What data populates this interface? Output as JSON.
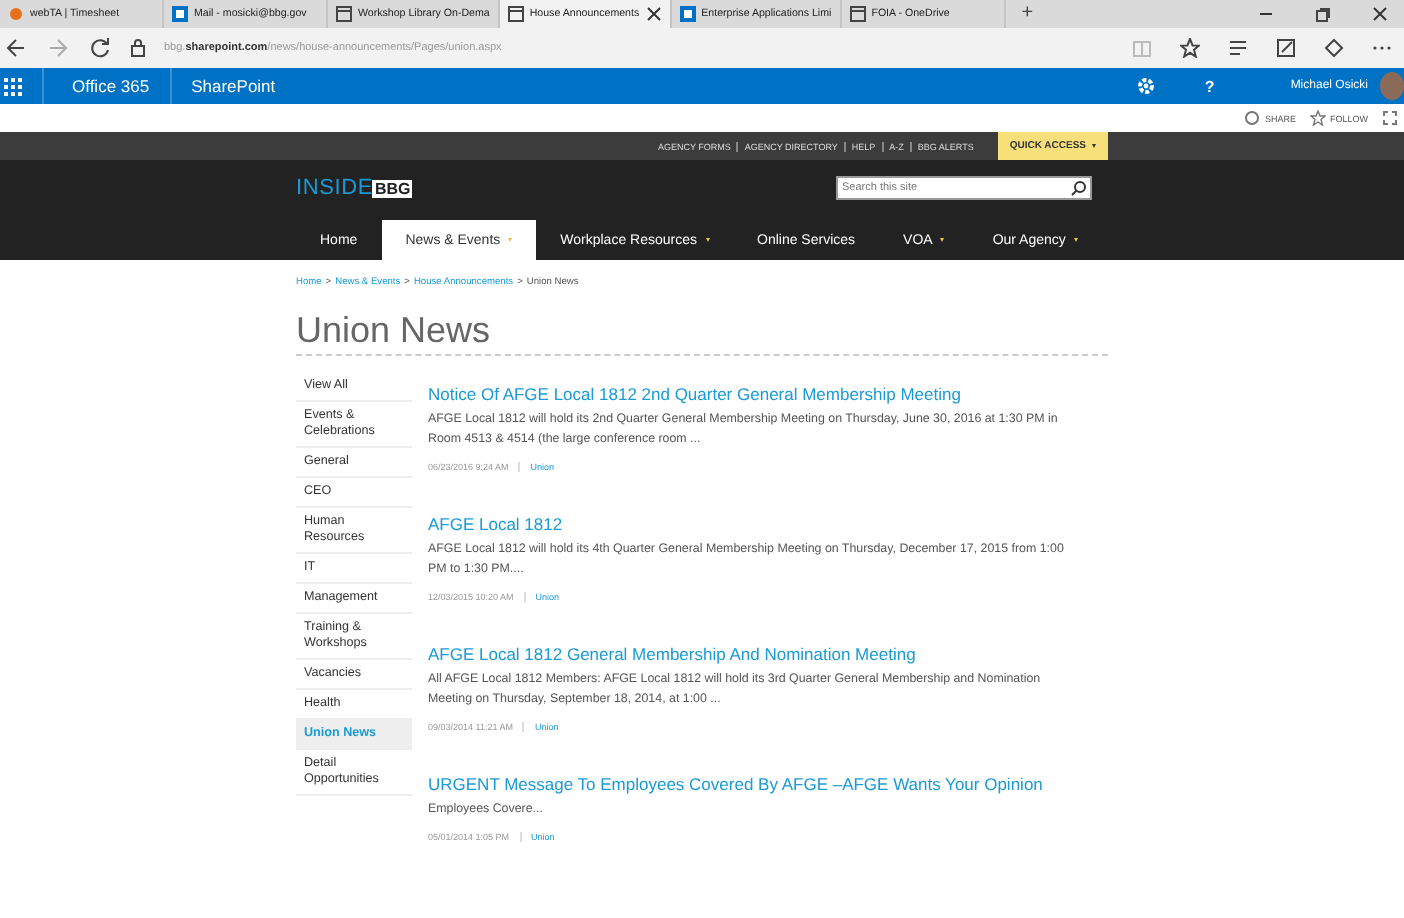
{
  "browser": {
    "tabs": [
      {
        "title": "webTA | Timesheet",
        "selected": false,
        "kind": "clock"
      },
      {
        "title": "Mail - mosicki@bbg.gov",
        "selected": false,
        "kind": "mail"
      },
      {
        "title": "Workshop Library On-Dema",
        "selected": false,
        "kind": "page"
      },
      {
        "title": "House Announcements",
        "selected": true,
        "kind": "page"
      },
      {
        "title": "Enterprise Applications Limi",
        "selected": false,
        "kind": "mail"
      },
      {
        "title": "FOIA - OneDrive",
        "selected": false,
        "kind": "page"
      }
    ],
    "new_tab": "+",
    "address": "bbg.**sharepoint.com**/news/house-announcements/Pages/union.aspx"
  },
  "suite_bar": {
    "app": "Office 365",
    "site": "SharePoint",
    "help": "?",
    "user": "Michael Osicki"
  },
  "actions": [
    "SHARE",
    "FOLLOW"
  ],
  "utility_links": [
    "AGENCY FORMS",
    "AGENCY DIRECTORY",
    "HELP",
    "A-Z",
    "BBG ALERTS"
  ],
  "quick_access": "QUICK ACCESS",
  "logo": {
    "text": "INSIDE",
    "badge": "BBG"
  },
  "search": {
    "placeholder": "Search this site"
  },
  "nav": [
    {
      "label": "Home",
      "selected": false,
      "dropdown": false
    },
    {
      "label": "News & Events",
      "selected": true,
      "dropdown": true
    },
    {
      "label": "Workplace Resources",
      "selected": false,
      "dropdown": true
    },
    {
      "label": "Online Services",
      "selected": false,
      "dropdown": false
    },
    {
      "label": "VOA",
      "selected": false,
      "dropdown": true
    },
    {
      "label": "Our Agency",
      "selected": false,
      "dropdown": true
    }
  ],
  "breadcrumb_separator": ">",
  "breadcrumb": [
    {
      "label": "Home",
      "link": true
    },
    {
      "label": "News & Events",
      "link": true
    },
    {
      "label": "House Announcements",
      "link": true
    },
    {
      "label": "Union News",
      "link": false
    }
  ],
  "page_title": "Union News",
  "sidebar": {
    "items": [
      {
        "label": "View All",
        "selected": false
      },
      {
        "label": "Events & Celebrations",
        "selected": false
      },
      {
        "label": "General",
        "selected": false
      },
      {
        "label": "CEO",
        "selected": false
      },
      {
        "label": "Human Resources",
        "selected": false
      },
      {
        "label": "IT",
        "selected": false
      },
      {
        "label": "Management",
        "selected": false
      },
      {
        "label": "Training & Workshops",
        "selected": false
      },
      {
        "label": "Vacancies",
        "selected": false
      },
      {
        "label": "Health",
        "selected": false
      },
      {
        "label": "Union News",
        "selected": true
      },
      {
        "label": "Detail Opportunities",
        "selected": false
      }
    ]
  },
  "articles": [
    {
      "title": "Notice Of AFGE Local 1812 2nd Quarter General Membership Meeting",
      "summary": "AFGE Local 1812 will hold its 2nd Quarter General Membership Meeting on Thursday, June 30, 2016 at 1:30 PM in Room 4513 & 4514 (the large conference room ...",
      "date": "06/23/2016 9:24 AM",
      "tag": "Union"
    },
    {
      "title": "AFGE Local 1812",
      "summary": "AFGE Local 1812 will hold its 4th Quarter General Membership Meeting on Thursday, December 17, 2015 from 1:00 PM to 1:30 PM....",
      "date": "12/03/2015 10:20 AM",
      "tag": "Union"
    },
    {
      "title": "AFGE Local 1812 General Membership And Nomination Meeting",
      "summary": "All AFGE Local 1812 Members: AFGE Local 1812 will hold its 3rd Quarter General Membership and Nomination Meeting on Thursday, September 18, 2014, at 1:00 ...",
      "date": "09/03/2014 11:21 AM",
      "tag": "Union"
    },
    {
      "title": "URGENT Message To Employees Covered By AFGE –AFGE Wants Your Opinion",
      "summary": "Employees Covere...",
      "date": "05/01/2014 1:05 PM",
      "tag": "Union"
    }
  ]
}
